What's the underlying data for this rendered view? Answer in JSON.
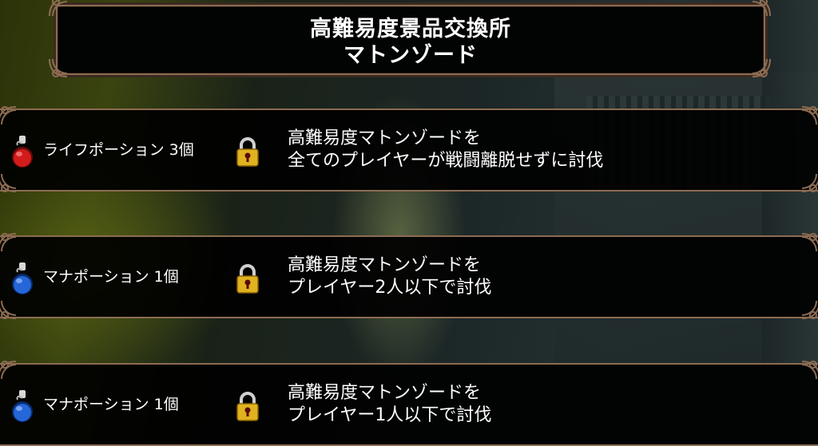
{
  "header": {
    "title_line1": "高難易度景品交換所",
    "title_line2": "マトンゾード"
  },
  "rewards": [
    {
      "icon": "red-potion-icon",
      "potion_color": "#d21c1c",
      "label": "ライフポーション 3個",
      "lock_icon": "padlock-icon",
      "condition_line1": "高難易度マトンゾードを",
      "condition_line2": "全てのプレイヤーが戦闘離脱せずに討伐"
    },
    {
      "icon": "blue-potion-icon",
      "potion_color": "#2566d8",
      "label": "マナポーション 1個",
      "lock_icon": "padlock-icon",
      "condition_line1": "高難易度マトンゾードを",
      "condition_line2": "プレイヤー2人以下で討伐"
    },
    {
      "icon": "blue-potion-icon",
      "potion_color": "#2566d8",
      "label": "マナポーション 1個",
      "lock_icon": "padlock-icon",
      "condition_line1": "高難易度マトンゾードを",
      "condition_line2": "プレイヤー1人以下で討伐"
    }
  ],
  "colors": {
    "frame": "#8c6c52",
    "panel": "#020303",
    "lock_gold": "#e0b21e"
  }
}
